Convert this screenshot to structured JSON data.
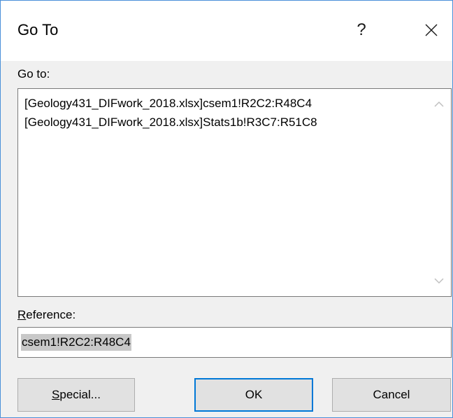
{
  "dialog": {
    "title": "Go To",
    "help_label": "?"
  },
  "goto_section": {
    "label": "Go to:",
    "items": [
      "[Geology431_DIFwork_2018.xlsx]csem1!R2C2:R48C4",
      "[Geology431_DIFwork_2018.xlsx]Stats1b!R3C7:R51C8"
    ]
  },
  "reference": {
    "label_mnemonic": "R",
    "label_rest": "eference:",
    "value": "csem1!R2C2:R48C4"
  },
  "buttons": {
    "special_mnemonic": "S",
    "special_rest": "pecial...",
    "ok": "OK",
    "cancel": "Cancel"
  },
  "colors": {
    "accent": "#0078d7",
    "background": "#f0f0f0"
  }
}
